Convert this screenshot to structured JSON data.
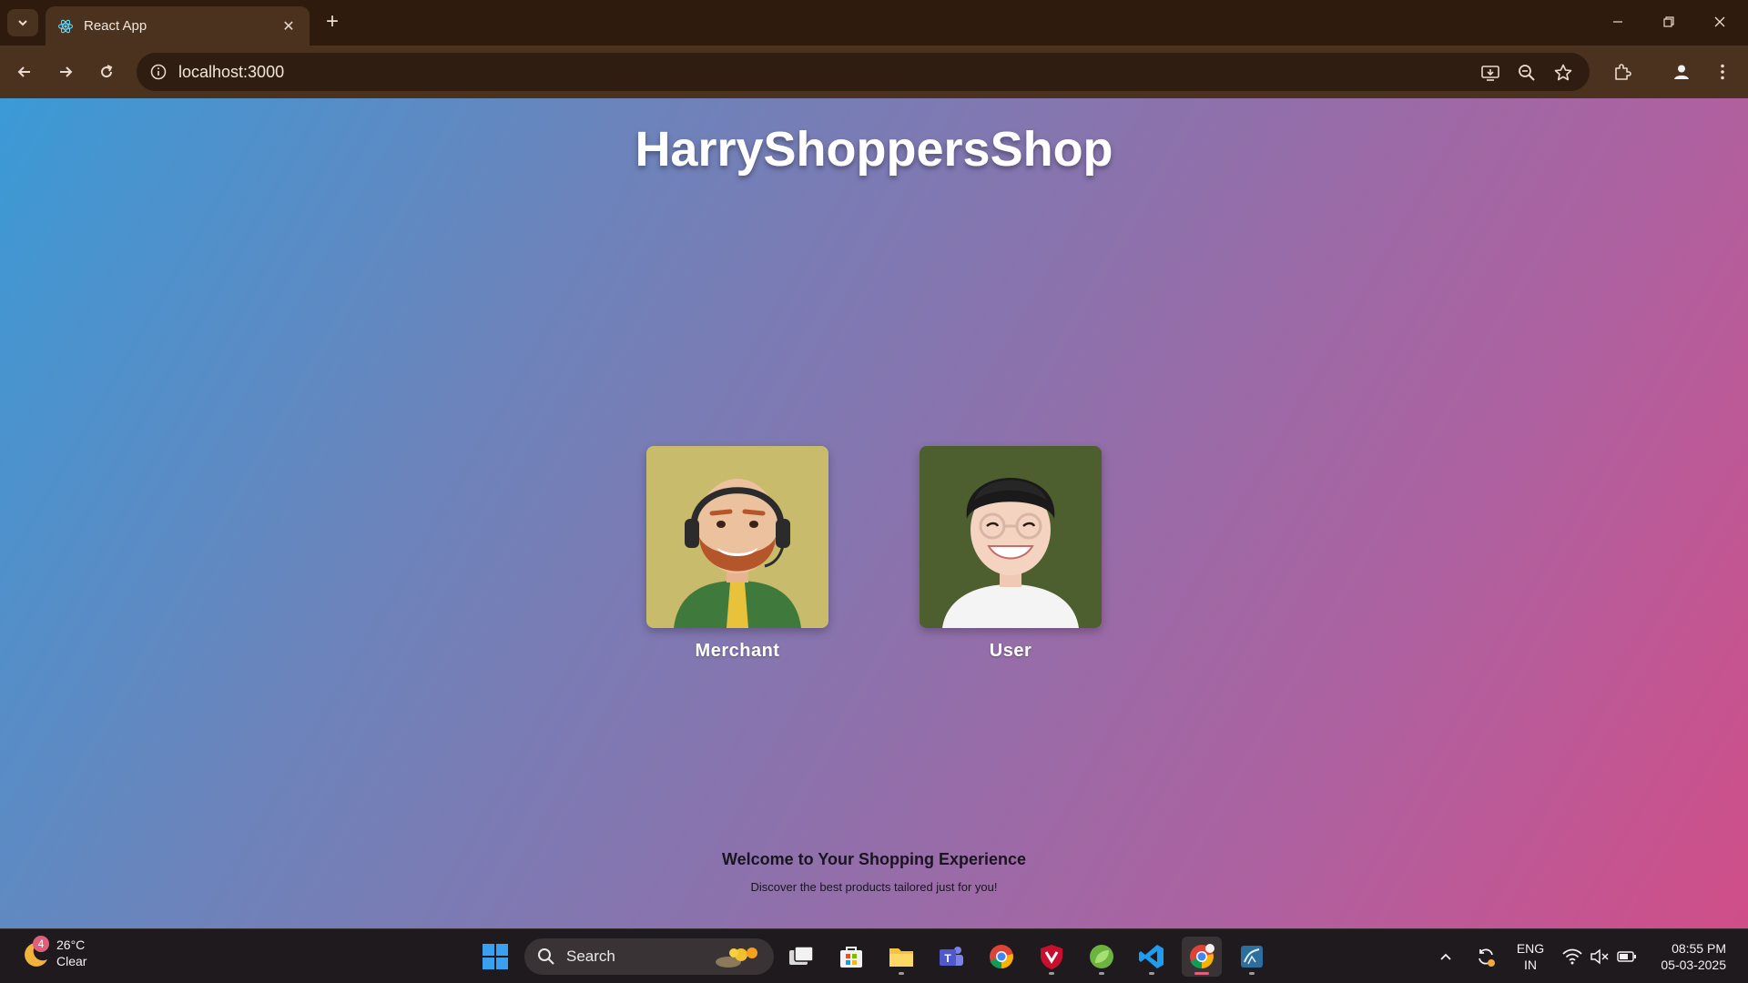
{
  "browser": {
    "tab_title": "React App",
    "url": "localhost:3000"
  },
  "page": {
    "title": "HarryShoppersShop",
    "cards": [
      {
        "label": "Merchant"
      },
      {
        "label": "User"
      }
    ],
    "welcome_heading": "Welcome to Your Shopping Experience",
    "welcome_subtext": "Discover the best products tailored just for you!"
  },
  "taskbar": {
    "weather_badge": "4",
    "temperature": "26°C",
    "condition": "Clear",
    "search_label": "Search",
    "lang_primary": "ENG",
    "lang_region": "IN",
    "time": "08:55 PM",
    "date": "05-03-2025"
  }
}
